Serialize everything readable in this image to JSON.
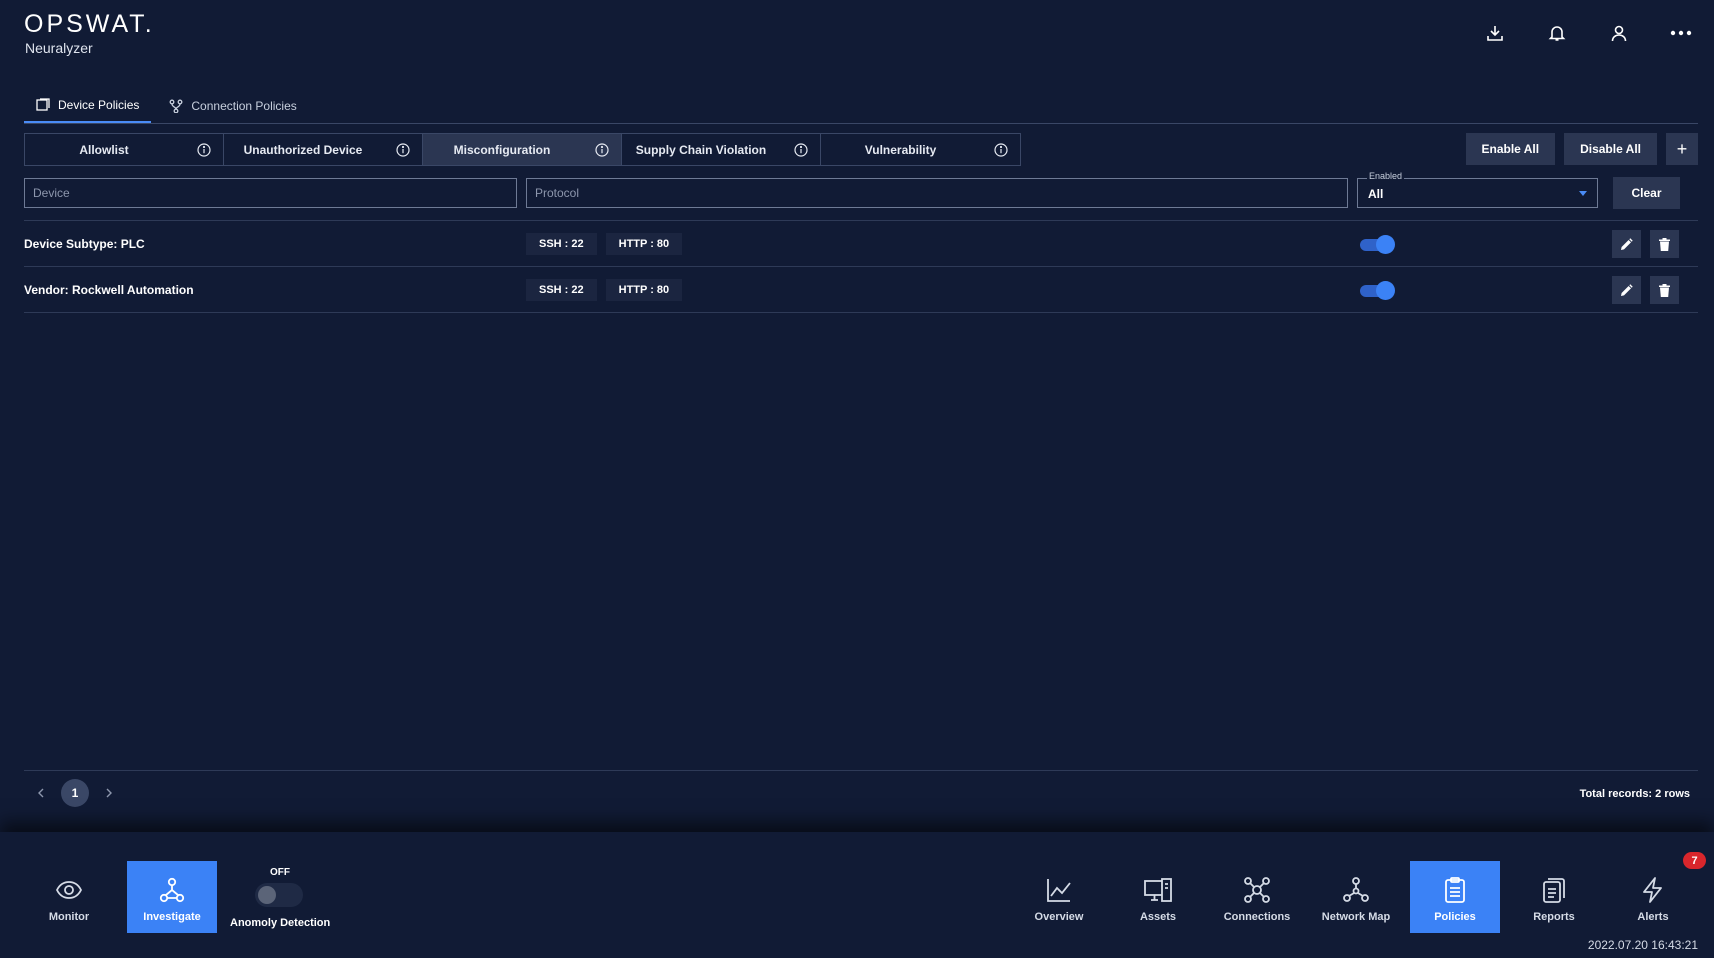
{
  "header": {
    "logo": "OPSWAT.",
    "subtitle": "Neuralyzer",
    "icons": [
      "download-icon",
      "bell-icon",
      "user-icon",
      "more-icon"
    ]
  },
  "tabs": [
    {
      "label": "Device Policies",
      "icon": "device-icon",
      "active": true
    },
    {
      "label": "Connection Policies",
      "icon": "branch-icon",
      "active": false
    }
  ],
  "categories": [
    {
      "label": "Allowlist",
      "active": false
    },
    {
      "label": "Unauthorized Device",
      "active": false
    },
    {
      "label": "Misconfiguration",
      "active": true
    },
    {
      "label": "Supply Chain Violation",
      "active": false
    },
    {
      "label": "Vulnerability",
      "active": false
    }
  ],
  "actions": {
    "enable_all": "Enable All",
    "disable_all": "Disable All",
    "add": "+"
  },
  "filters": {
    "device_placeholder": "Device",
    "protocol_placeholder": "Protocol",
    "enabled_label": "Enabled",
    "enabled_value": "All",
    "clear": "Clear"
  },
  "rows": [
    {
      "name": "Device Subtype: PLC",
      "protocols": [
        "SSH : 22",
        "HTTP : 80"
      ],
      "enabled": true
    },
    {
      "name": "Vendor: Rockwell Automation",
      "protocols": [
        "SSH : 22",
        "HTTP : 80"
      ],
      "enabled": true
    }
  ],
  "pagination": {
    "current_page": "1",
    "total": "Total records: 2 rows"
  },
  "dock": {
    "left": [
      {
        "label": "Monitor",
        "icon": "eye-icon",
        "active": false
      },
      {
        "label": "Investigate",
        "icon": "hierarchy-icon",
        "active": true
      }
    ],
    "anomaly": {
      "state": "OFF",
      "label": "Anomoly Detection"
    },
    "right": [
      {
        "label": "Overview",
        "icon": "chart-line-icon",
        "active": false
      },
      {
        "label": "Assets",
        "icon": "devices-icon",
        "active": false
      },
      {
        "label": "Connections",
        "icon": "connections-icon",
        "active": false
      },
      {
        "label": "Network Map",
        "icon": "network-map-icon",
        "active": false
      },
      {
        "label": "Policies",
        "icon": "clipboard-icon",
        "active": true
      },
      {
        "label": "Reports",
        "icon": "reports-icon",
        "active": false
      },
      {
        "label": "Alerts",
        "icon": "bolt-icon",
        "active": false
      }
    ],
    "alerts_badge": "7"
  },
  "timestamp": "2022.07.20 16:43:21",
  "colors": {
    "background": "#111b35",
    "accent": "#3b82f6",
    "panel": "#2b3652",
    "badge": "#d9262c"
  }
}
